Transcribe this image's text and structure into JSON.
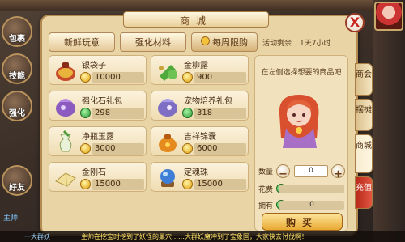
{
  "hud": {
    "left_buttons": [
      "包裹",
      "技能",
      "强化",
      "好友"
    ],
    "left_text": "主帅",
    "bottom_chat": "主帅在挖宝时挖到了妖怪的巢穴……大群妖魔冲到了宝象国，大家快去讨伐啊！",
    "bottom_side": "一大群妖"
  },
  "window": {
    "title": "商城",
    "close_label": "X",
    "tabs": [
      "新鲜玩意",
      "强化材料",
      "每周限购"
    ],
    "active_tab": "每周限购",
    "remaining_label": "活动剩余",
    "remaining_value": "1天7小时"
  },
  "items": [
    {
      "name": "银袋子",
      "price": "10000",
      "icon": "money-bag-icon"
    },
    {
      "name": "金柳露",
      "price": "900",
      "icon": "green-potion-icon"
    },
    {
      "name": "强化石礼包",
      "price": "298",
      "icon": "stone-pack-icon"
    },
    {
      "name": "宠物培养礼包",
      "price": "318",
      "icon": "pet-pack-icon"
    },
    {
      "name": "净瓶玉露",
      "price": "3000",
      "icon": "vase-icon"
    },
    {
      "name": "吉祥锦囊",
      "price": "6000",
      "icon": "pouch-icon"
    },
    {
      "name": "金刚石",
      "price": "15000",
      "icon": "diamond-icon"
    },
    {
      "name": "定魂珠",
      "price": "15000",
      "icon": "orb-icon"
    }
  ],
  "detail": {
    "hint": "在左侧选择想要的商品吧",
    "qty_label": "数量",
    "qty_value": "0",
    "cost_label": "花费",
    "cost_value": "",
    "own_label": "拥有",
    "own_value": "0",
    "buy_label": "购买",
    "minus": "−",
    "plus": "+"
  },
  "side_tabs": [
    {
      "label": "商会"
    },
    {
      "label": "摆摊"
    },
    {
      "label": "商城"
    },
    {
      "label": "充值"
    }
  ],
  "colors": {
    "panel": "#e9d4a5",
    "accent": "#c8281e",
    "coin": "#e0a10f"
  }
}
